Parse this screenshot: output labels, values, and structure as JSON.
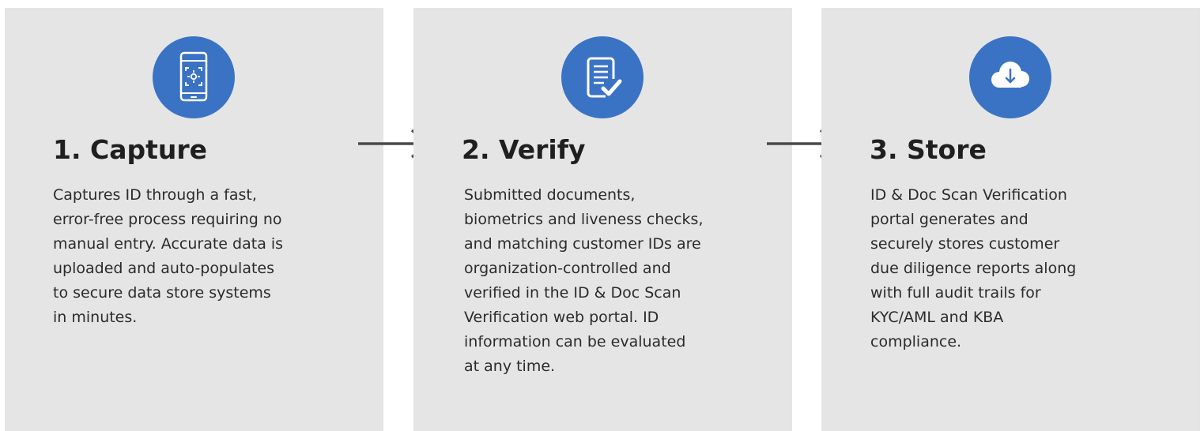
{
  "colors": {
    "card_background": "#e5e5e5",
    "icon_background": "#3a73c4",
    "title_text": "#1f1f1f",
    "body_text": "#2b2b2b",
    "arrow": "#4a4a4a"
  },
  "steps": [
    {
      "icon": "phone-scan-icon",
      "title": "1. Capture",
      "description_lines": [
        "Captures ID through a fast,",
        "error-free process requiring no",
        "manual entry. Accurate data is",
        "uploaded and auto-populates",
        "to secure data store systems",
        "in minutes."
      ]
    },
    {
      "icon": "document-check-icon",
      "title": "2. Verify",
      "description_lines": [
        "Submitted documents,",
        "biometrics and liveness checks,",
        "and matching customer IDs are",
        "organization-controlled and",
        "verified in the ID & Doc Scan",
        "Verification web portal. ID",
        "information can be evaluated",
        "at any time."
      ]
    },
    {
      "icon": "cloud-download-icon",
      "title": "3. Store",
      "description_lines": [
        "ID & Doc Scan Verification",
        "portal generates and",
        "securely stores customer",
        "due diligence reports along",
        "with full audit trails for",
        "KYC/AML and KBA",
        "compliance."
      ]
    }
  ]
}
